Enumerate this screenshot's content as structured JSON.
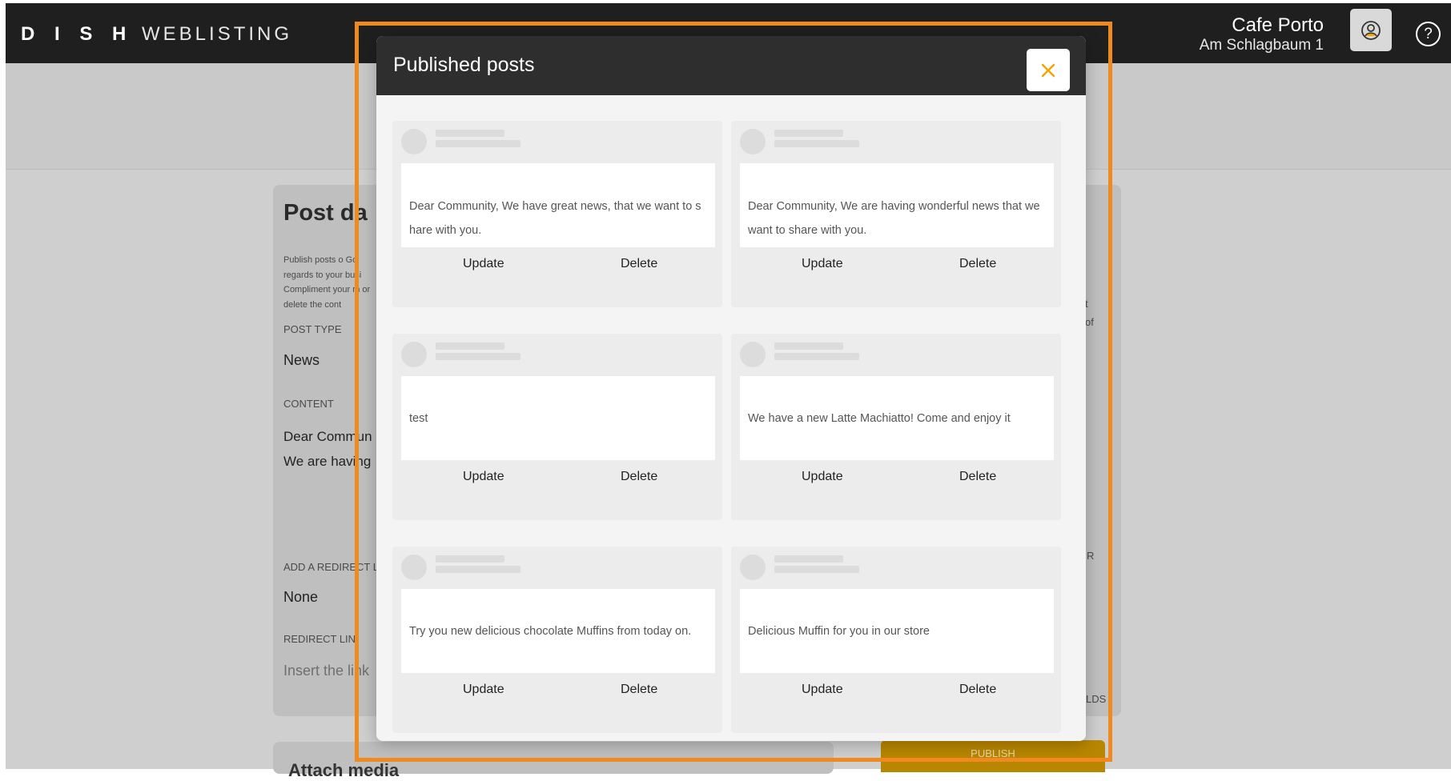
{
  "topbar": {
    "logo_strong": "D I S H",
    "logo_light": "WEBLISTING",
    "venue_name": "Cafe Porto",
    "venue_address": "Am Schlagbaum 1",
    "avatar_icon": "user-circle-icon",
    "help_label": "?"
  },
  "background": {
    "title": "Post da",
    "description": "Publish posts o  Go regards to your busi Compliment your m or delete the cont",
    "post_type_label": "POST TYPE",
    "post_type_value": "News",
    "content_label": "CONTENT",
    "content_line1": "Dear Commun",
    "content_line2": "We are having",
    "redirect_label": "ADD A REDIRECT L",
    "redirect_value": "None",
    "redirect_link_label": "REDIRECT LIN",
    "redirect_link_placeholder": "Insert the link",
    "right_fragment_1": "t",
    "right_fragment_2": "of",
    "right_fragment_3": "R",
    "right_fragment_4": "LDS",
    "publish_label": "PUBLISH",
    "bottom_title": "Attach media"
  },
  "modal": {
    "title": "Published posts",
    "close_icon": "close-x-icon",
    "accent": "#f0a500",
    "posts": [
      {
        "text": "Dear Community, We have great news, that we want to share with you.",
        "update_label": "Update",
        "delete_label": "Delete"
      },
      {
        "text": "Dear Community, We are having wonderful news that we want to share with you.",
        "update_label": "Update",
        "delete_label": "Delete"
      },
      {
        "text": "test",
        "update_label": "Update",
        "delete_label": "Delete"
      },
      {
        "text": "We have a new Latte Machiatto! Come and enjoy it",
        "update_label": "Update",
        "delete_label": "Delete"
      },
      {
        "text": "Try you new delicious chocolate Muffins from today on.",
        "update_label": "Update",
        "delete_label": "Delete"
      },
      {
        "text": "Delicious Muffin for you in our store",
        "update_label": "Update",
        "delete_label": "Delete"
      }
    ]
  },
  "highlight_color": "#f0891f"
}
